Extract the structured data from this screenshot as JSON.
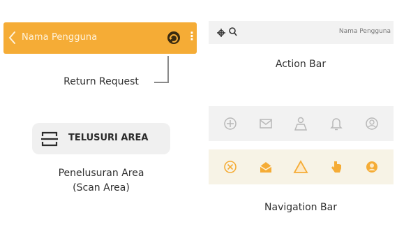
{
  "return_request": {
    "header_title": "Nama Pengguna",
    "label": "Return Request"
  },
  "scan_area": {
    "button_label": "TELUSURI AREA",
    "label_line1": "Penelusuran Area",
    "label_line2": "(Scan Area)"
  },
  "action_bar": {
    "user_name": "Nama Pengguna",
    "label": "Action Bar",
    "icons": [
      "pin-icon",
      "search-icon"
    ]
  },
  "navigation_bar": {
    "label": "Navigation Bar",
    "inactive_icons": [
      "add-circle-icon",
      "mail-icon",
      "map-user-icon",
      "bell-icon",
      "profile-icon"
    ],
    "active_icons": [
      "close-circle-icon",
      "mail-open-icon",
      "warning-icon",
      "hand-pointer-icon",
      "avatar-icon"
    ]
  },
  "colors": {
    "accent_orange": "#f5ac36",
    "icon_inactive": "#b8b8b8",
    "bar_background": "#f2f2f2",
    "label_text": "#2f2f2f"
  }
}
